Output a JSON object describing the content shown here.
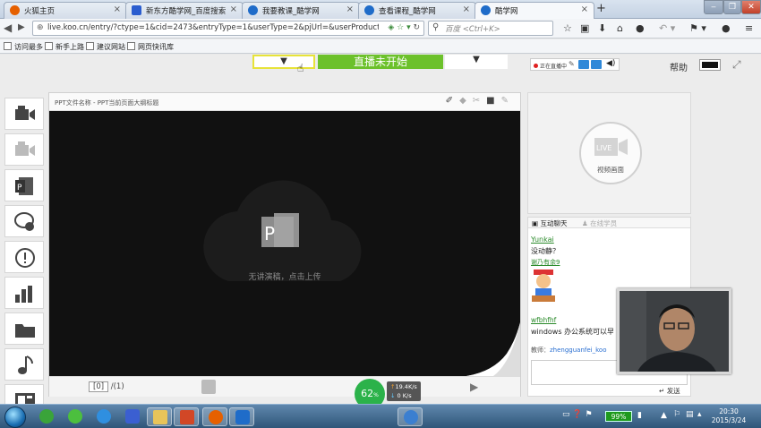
{
  "browser": {
    "tabs": [
      {
        "label": "火狐主页",
        "active": false
      },
      {
        "label": "新东方酷学网_百度搜索",
        "active": false
      },
      {
        "label": "我要教课_酷学网",
        "active": false
      },
      {
        "label": "查看课程_酷学网",
        "active": false
      },
      {
        "label": "酷学网",
        "active": true
      }
    ],
    "url": "live.koo.cn/entry/?ctype=1&cid=2473&entryType=1&userType=2&pjUrl=&userProductId=&product",
    "search_placeholder": "百度 <Ctrl+K>",
    "bookmarks": [
      "访问最多",
      "新手上路",
      "建议网站",
      "网页快讯库"
    ]
  },
  "page": {
    "live_status_button": "直播未开始",
    "dropdown_arrow": "▼",
    "status_panel_text": "正在直播中",
    "help_label": "帮助",
    "ppt": {
      "title": "PPT文件名称 - PPT当前页面大纲标题",
      "placeholder": "无讲演稿，点击上传",
      "page_current": "[0]",
      "page_total": "/(1)"
    },
    "network": {
      "percent": "62",
      "percent_unit": "%",
      "upload": "19.4",
      "download": "0",
      "unit": "K/s"
    },
    "video": {
      "live_badge": "LIVE",
      "label": "视频画面"
    },
    "chat": {
      "tab_chat": "互动聊天",
      "tab_online": "在线学员",
      "messages": [
        {
          "user": "Yunkai",
          "text": "没动静？"
        },
        {
          "user": "谢乃有余9",
          "text": ""
        },
        {
          "user": "wfbhfhf",
          "text": "windows 办公系统可以早"
        }
      ],
      "teacher_label": "教师：",
      "teacher_name": "zhengguanfei_koo",
      "send_label": "发送"
    }
  },
  "taskbar": {
    "battery": "99%",
    "time": "20:30",
    "date": "2015/3/24"
  },
  "colors": {
    "live_button": "#6cc12b",
    "ppt_canvas": "#111111",
    "chat_user": "#2a8a2a",
    "network_circle": "#2bb24a"
  }
}
